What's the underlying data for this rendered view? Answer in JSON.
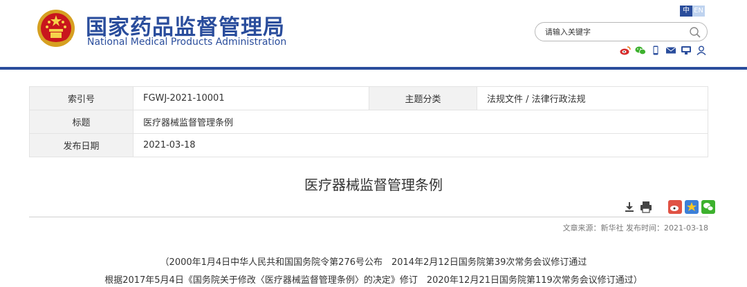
{
  "header": {
    "site_name_cn": "国家药品监督管理局",
    "site_name_en": "National Medical Products Administration",
    "lang_zh": "中",
    "lang_en": "EN",
    "search_placeholder": "请输入关键字",
    "social_icons": [
      "weibo-icon",
      "wechat-icon",
      "mobile-icon",
      "mail-icon",
      "monitor-icon",
      "user-icon"
    ],
    "brand_color": "#2a4d9c"
  },
  "info_table": {
    "index_label": "索引号",
    "index_value": "FGWJ-2021-10001",
    "category_label": "主题分类",
    "category_value": "法规文件 / 法律行政法规",
    "title_label": "标题",
    "title_value": "医疗器械监督管理条例",
    "date_label": "发布日期",
    "date_value": "2021-03-18"
  },
  "article": {
    "title": "医疗器械监督管理条例",
    "source_line": "文章来源：新华社 发布时间：2021-03-18",
    "body_line_1": "（2000年1月4日中华人民共和国国务院令第276号公布　2014年2月12日国务院第39次常务会议修订通过",
    "body_line_2": "根据2017年5月4日《国务院关于修改〈医疗器械监督管理条例〉的决定》修订　2020年12月21日国务院第119次常务会议修订通过）"
  },
  "tools": {
    "icons": [
      "download-icon",
      "print-icon",
      "share-weibo-icon",
      "share-qzone-icon",
      "share-wechat-icon"
    ]
  }
}
